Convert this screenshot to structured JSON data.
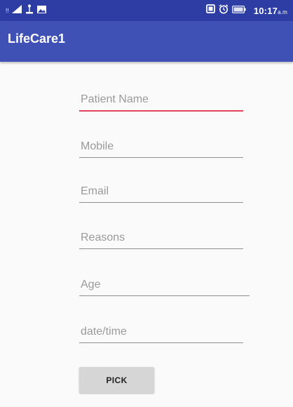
{
  "status_bar": {
    "carrier_indicator": "!!",
    "time": "10:17",
    "time_suffix": "a.m",
    "icons": [
      "signal-icon",
      "usb-icon",
      "image-icon",
      "notification-icon",
      "alarm-icon",
      "battery-icon"
    ]
  },
  "app_bar": {
    "title": "LifeCare1",
    "color": "#3f51b5",
    "status_color": "#2d3da3"
  },
  "form": {
    "patient_name_placeholder": "Patient Name",
    "mobile_placeholder": "Mobile",
    "email_placeholder": "Email",
    "reasons_placeholder": "Reasons",
    "age_placeholder": "Age",
    "datetime_placeholder": "date/time",
    "pick_label": "PICK",
    "focus_color": "#e0455c"
  }
}
